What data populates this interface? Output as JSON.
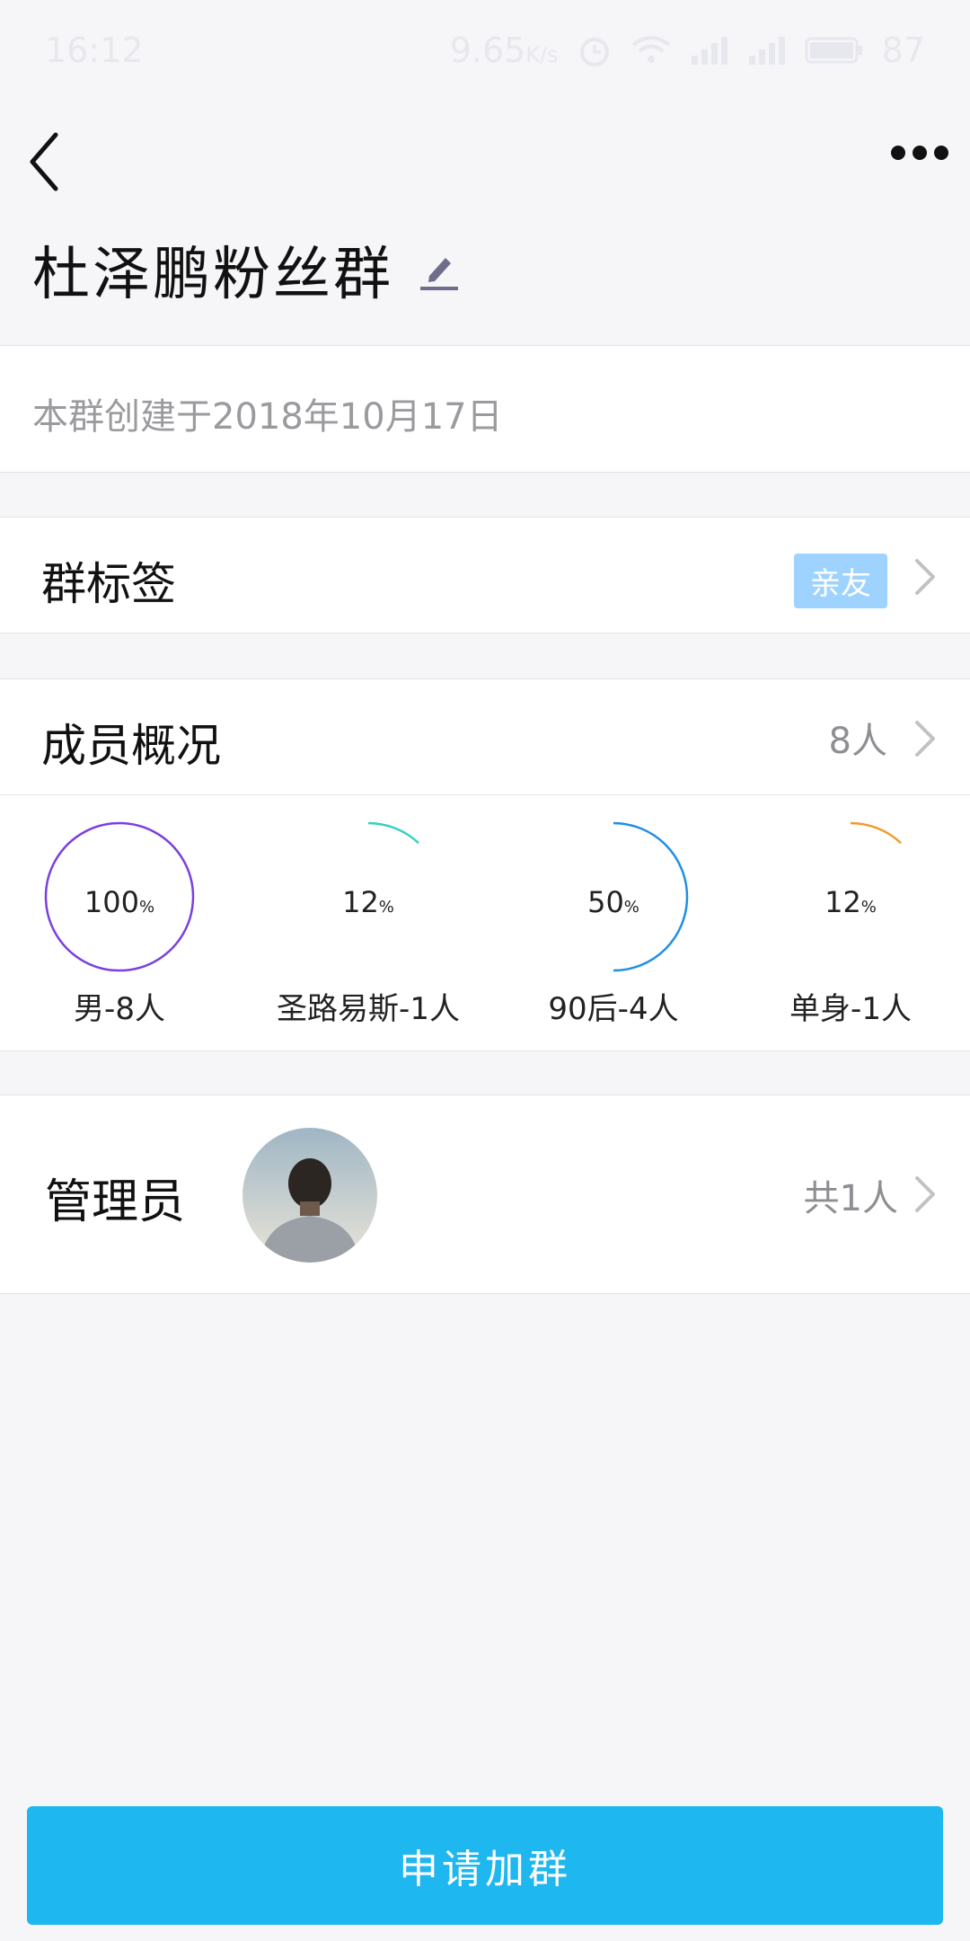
{
  "status_bar": {
    "time": "16:12",
    "network_speed": "9.65",
    "network_unit": "K/s",
    "battery": "87"
  },
  "header": {
    "title": "杜泽鹏粉丝群",
    "back_icon": "chevron-left-icon",
    "more_icon": "more-dots-icon",
    "edit_icon": "pencil-icon"
  },
  "created_text": "本群创建于2018年10月17日",
  "tags_section": {
    "label": "群标签",
    "tag": "亲友"
  },
  "members_section": {
    "label": "成员概况",
    "count": "8人"
  },
  "member_stats": [
    {
      "percent": "100",
      "unit": "%",
      "caption": "男-8人",
      "value": 1.0,
      "color": "#7b3fe0"
    },
    {
      "percent": "12",
      "unit": "%",
      "caption": "圣路易斯-1人",
      "value": 0.12,
      "color": "#36d1c0"
    },
    {
      "percent": "50",
      "unit": "%",
      "caption": "90后-4人",
      "value": 0.5,
      "color": "#1e8fe6"
    },
    {
      "percent": "12",
      "unit": "%",
      "caption": "单身-1人",
      "value": 0.12,
      "color": "#f39a2b"
    }
  ],
  "admin_section": {
    "label": "管理员",
    "count": "共1人",
    "avatar": "admin-avatar"
  },
  "action": {
    "apply_label": "申请加群"
  },
  "colors": {
    "accent": "#1fb7ef",
    "tag_bg": "#9fd3ff",
    "background": "#f6f6f9"
  }
}
